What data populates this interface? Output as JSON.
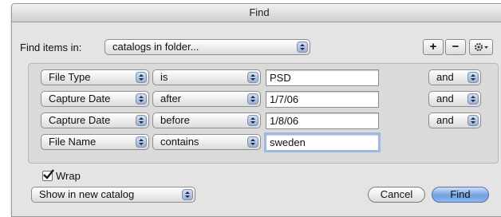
{
  "window": {
    "title": "Find"
  },
  "find_in": {
    "label": "Find items in:",
    "value": "catalogs in folder..."
  },
  "toolbar": {
    "add_label": "+",
    "remove_label": "−"
  },
  "rows": [
    {
      "field": "File Type",
      "operator": "is",
      "value": "PSD",
      "conjunction": "and"
    },
    {
      "field": "Capture Date",
      "operator": "after",
      "value": "1/7/06",
      "conjunction": "and"
    },
    {
      "field": "Capture Date",
      "operator": "before",
      "value": "1/8/06",
      "conjunction": "and"
    },
    {
      "field": "File Name",
      "operator": "contains",
      "value": "sweden",
      "conjunction": ""
    }
  ],
  "options": {
    "wrap_label": "Wrap",
    "wrap_checked": true,
    "output": "Show in new catalog"
  },
  "buttons": {
    "cancel": "Cancel",
    "find": "Find"
  },
  "icons": {
    "gear": "gear-icon",
    "popup_arrows": "popup-arrows-icon",
    "checkmark": "checkmark-icon"
  },
  "colors": {
    "accent": "#7aa6e6",
    "focus_ring": "#9cb9e3",
    "window_bg": "#e4e4e4"
  }
}
